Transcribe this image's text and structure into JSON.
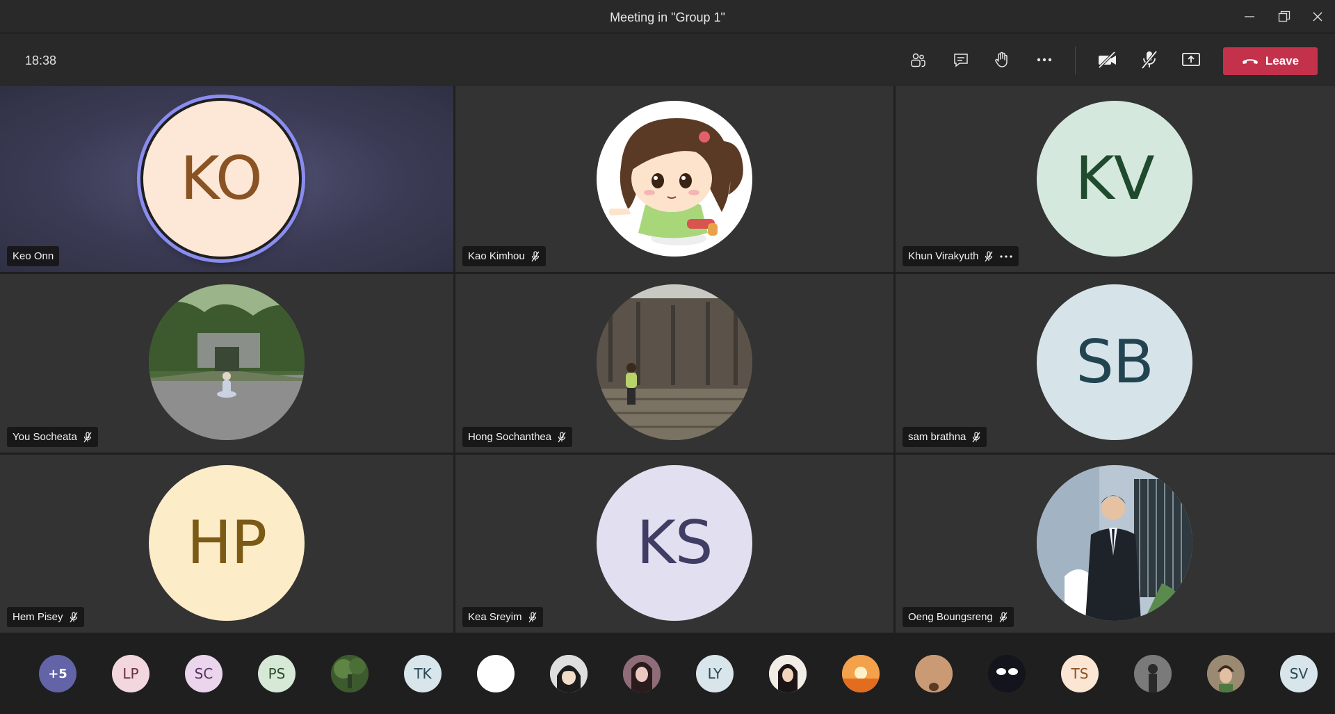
{
  "window": {
    "title": "Meeting in \"Group 1\""
  },
  "toolbar": {
    "time": "18:38",
    "leave_label": "Leave",
    "buttons": [
      "participants-icon",
      "chat-icon",
      "raise-hand-icon",
      "more-icon",
      "camera-off-icon",
      "mic-off-icon",
      "share-screen-icon"
    ]
  },
  "tiles": [
    {
      "name": "Keo Onn",
      "initials": "KO",
      "bg": "#fde7d7",
      "fg": "#8a5323",
      "speaking": true,
      "muted": false
    },
    {
      "name": "Kao Kimhou",
      "initials": "",
      "bg": "#ffffff",
      "photo": "cartoon-girl",
      "muted": true
    },
    {
      "name": "Khun Virakyuth",
      "initials": "KV",
      "bg": "#d5e8dd",
      "fg": "#1f4a2e",
      "muted": true,
      "more": true
    },
    {
      "name": "You Socheata",
      "initials": "",
      "photo": "park",
      "muted": true
    },
    {
      "name": "Hong Sochanthea",
      "initials": "",
      "photo": "temple-wall",
      "muted": true
    },
    {
      "name": "sam brathna",
      "initials": "SB",
      "bg": "#d6e4e9",
      "fg": "#224451",
      "muted": true
    },
    {
      "name": "Hem Pisey",
      "initials": "HP",
      "bg": "#fcecc8",
      "fg": "#7b5a16",
      "muted": true
    },
    {
      "name": "Kea Sreyim",
      "initials": "KS",
      "bg": "#e1dff0",
      "fg": "#3f3d63",
      "muted": true
    },
    {
      "name": "Oeng Boungsreng",
      "initials": "",
      "photo": "man-suit",
      "muted": true
    }
  ],
  "strip": [
    {
      "label": "+5",
      "bg": "#6264a7",
      "fg": "#ffffff"
    },
    {
      "label": "LP",
      "bg": "#f2d7de",
      "fg": "#6b2f3d"
    },
    {
      "label": "SC",
      "bg": "#ead5ec",
      "fg": "#5b3164"
    },
    {
      "label": "PS",
      "bg": "#d6e8d6",
      "fg": "#2b4f2b"
    },
    {
      "label": "",
      "photo": "green",
      "bg": "#4d6b3a"
    },
    {
      "label": "TK",
      "bg": "#d8e5ea",
      "fg": "#2a4855"
    },
    {
      "label": "",
      "bg": "#ffffff"
    },
    {
      "label": "",
      "photo": "anime",
      "bg": "#c9c9c9"
    },
    {
      "label": "",
      "photo": "selfie",
      "bg": "#b48e9a"
    },
    {
      "label": "LY",
      "bg": "#d8e5ea",
      "fg": "#2a4855"
    },
    {
      "label": "",
      "photo": "girl",
      "bg": "#e9e2da"
    },
    {
      "label": "",
      "photo": "sunset",
      "bg": "#ef8f3a"
    },
    {
      "label": "",
      "photo": "tan",
      "bg": "#c99a73"
    },
    {
      "label": "",
      "photo": "dark",
      "bg": "#1a1a22"
    },
    {
      "label": "TS",
      "bg": "#fbe6d4",
      "fg": "#8a5323"
    },
    {
      "label": "",
      "photo": "gray",
      "bg": "#6c6c6c"
    },
    {
      "label": "",
      "photo": "boy",
      "bg": "#8d7b63"
    },
    {
      "label": "SV",
      "bg": "#d8e5ea",
      "fg": "#2a4855"
    }
  ]
}
